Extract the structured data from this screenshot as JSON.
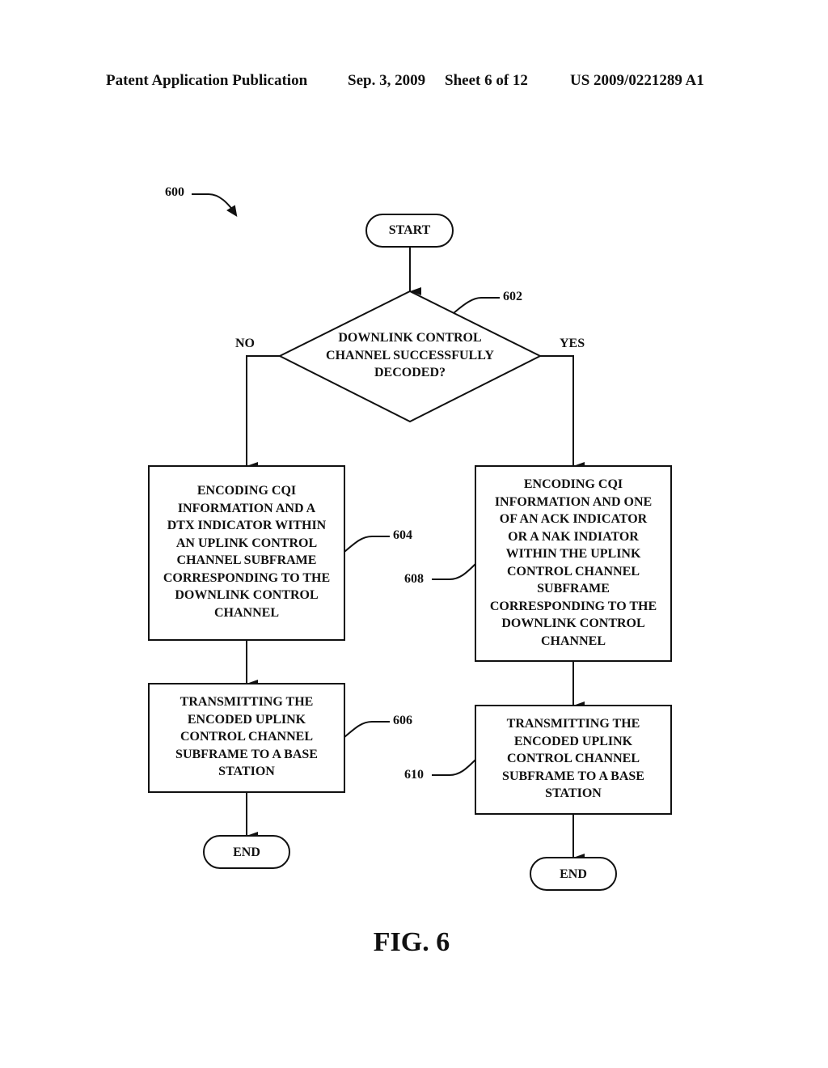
{
  "header": {
    "publication_type": "Patent Application Publication",
    "date": "Sep. 3, 2009",
    "sheet": "Sheet 6 of 12",
    "patent_number": "US 2009/0221289 A1"
  },
  "diagram": {
    "figure_ref": "600",
    "start": "START",
    "decision": {
      "ref": "602",
      "lines": [
        "DOWNLINK CONTROL",
        "CHANNEL SUCCESSFULLY",
        "DECODED?"
      ],
      "no_label": "NO",
      "yes_label": "YES"
    },
    "left_branch": {
      "step1": {
        "ref": "604",
        "lines": [
          "ENCODING CQI",
          "INFORMATION AND A",
          "DTX INDICATOR WITHIN",
          "AN UPLINK CONTROL",
          "CHANNEL SUBFRAME",
          "CORRESPONDING TO THE",
          "DOWNLINK CONTROL",
          "CHANNEL"
        ]
      },
      "step2": {
        "ref": "606",
        "lines": [
          "TRANSMITTING THE",
          "ENCODED UPLINK",
          "CONTROL CHANNEL",
          "SUBFRAME TO A BASE",
          "STATION"
        ]
      },
      "end": "END"
    },
    "right_branch": {
      "step1": {
        "ref": "608",
        "lines": [
          "ENCODING CQI",
          "INFORMATION AND ONE",
          "OF AN ACK INDICATOR",
          "OR A NAK INDIATOR",
          "WITHIN THE UPLINK",
          "CONTROL CHANNEL",
          "SUBFRAME",
          "CORRESPONDING TO THE",
          "DOWNLINK CONTROL",
          "CHANNEL"
        ]
      },
      "step2": {
        "ref": "610",
        "lines": [
          "TRANSMITTING THE",
          "ENCODED UPLINK",
          "CONTROL CHANNEL",
          "SUBFRAME TO A BASE",
          "STATION"
        ]
      },
      "end": "END"
    },
    "caption": "FIG. 6"
  }
}
